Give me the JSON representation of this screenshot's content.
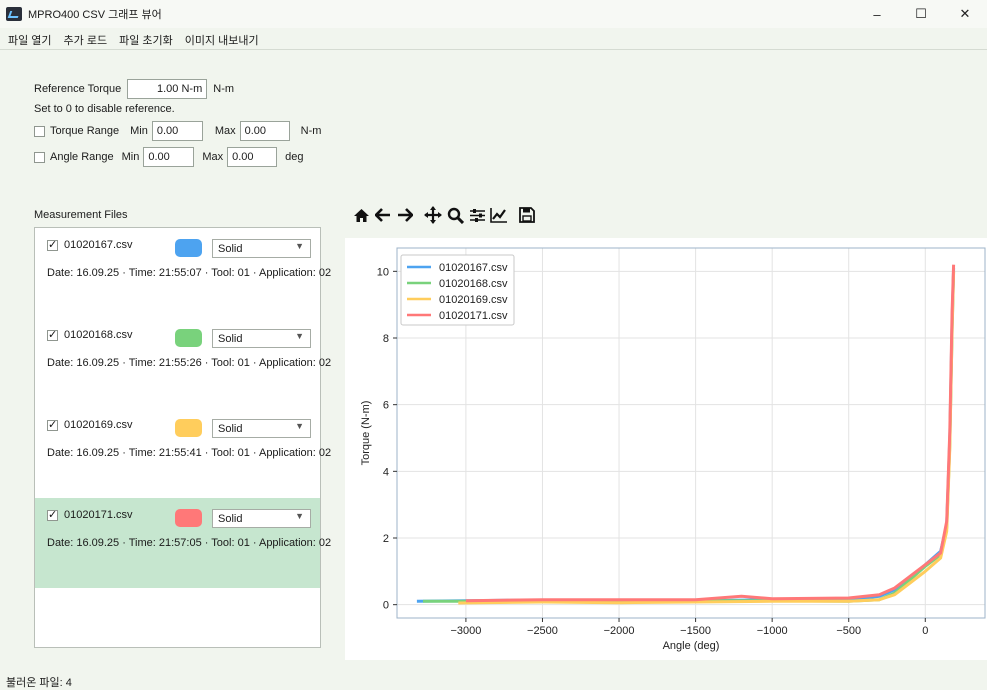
{
  "window": {
    "title": "MPRO400 CSV 그래프 뷰어",
    "icon": "app-chart-icon",
    "controls": [
      "–",
      "☐",
      "✕"
    ]
  },
  "menu": [
    "파일 열기",
    "추가 로드",
    "파일 초기화",
    "이미지 내보내기"
  ],
  "settings": {
    "ref_label": "Reference Torque",
    "ref_value": "1.00 N-m",
    "ref_unit": "N-m",
    "ref_hint": "Set to 0 to disable reference.",
    "torque_range": {
      "label": "Torque Range",
      "min_label": "Min",
      "min": "0.00",
      "max_label": "Max",
      "max": "0.00",
      "unit": "N-m",
      "checked": false
    },
    "angle_range": {
      "label": "Angle Range",
      "min_label": "Min",
      "min": "0.00",
      "max_label": "Max",
      "max": "0.00",
      "unit": "deg",
      "checked": false
    }
  },
  "files_label": "Measurement Files",
  "files": [
    {
      "name": "01020167.csv",
      "color": "#4da3f0",
      "style": "Solid",
      "info": "Date: 16.09.25 · Time: 21:55:07 · Tool: 01 · Application: 02",
      "checked": true,
      "selected": false
    },
    {
      "name": "01020168.csv",
      "color": "#79d27c",
      "style": "Solid",
      "info": "Date: 16.09.25 · Time: 21:55:26 · Tool: 01 · Application: 02",
      "checked": true,
      "selected": false
    },
    {
      "name": "01020169.csv",
      "color": "#ffcd5c",
      "style": "Solid",
      "info": "Date: 16.09.25 · Time: 21:55:41 · Tool: 01 · Application: 02",
      "checked": true,
      "selected": false
    },
    {
      "name": "01020171.csv",
      "color": "#ff7878",
      "style": "Solid",
      "info": "Date: 16.09.25 · Time: 21:57:05 · Tool: 01 · Application: 02",
      "checked": true,
      "selected": true
    }
  ],
  "toolbar": [
    "home-icon",
    "back-icon",
    "forward-icon",
    "pan-icon",
    "zoom-icon",
    "configure-subplots-icon",
    "edit-axis-icon",
    "save-icon"
  ],
  "chart_data": {
    "type": "line",
    "xlabel": "Angle (deg)",
    "ylabel": "Torque (N-m)",
    "xlim": [
      -3450,
      390
    ],
    "ylim": [
      -0.4,
      10.7
    ],
    "xticks": [
      -3000,
      -2500,
      -2000,
      -1500,
      -1000,
      -500,
      0
    ],
    "xtick_labels": [
      "−3000",
      "−2500",
      "−2000",
      "−1500",
      "−1000",
      "−500",
      "0"
    ],
    "yticks": [
      0,
      2,
      4,
      6,
      8,
      10
    ],
    "ytick_labels": [
      "0",
      "2",
      "4",
      "6",
      "8",
      "10"
    ],
    "grid": true,
    "legend_position": "top-left",
    "series": [
      {
        "name": "01020167.csv",
        "color": "#4da3f0",
        "x": [
          -3320,
          -3000,
          -2500,
          -2000,
          -1500,
          -1000,
          -500,
          -300,
          -200,
          -100,
          0,
          100,
          140,
          160,
          175,
          185
        ],
        "y": [
          0.1,
          0.12,
          0.14,
          0.12,
          0.12,
          0.15,
          0.15,
          0.25,
          0.45,
          0.8,
          1.2,
          1.6,
          2.4,
          5.0,
          8.5,
          10.1
        ]
      },
      {
        "name": "01020168.csv",
        "color": "#79d27c",
        "x": [
          -3280,
          -3000,
          -2500,
          -2000,
          -1500,
          -1000,
          -500,
          -300,
          -200,
          -100,
          0,
          100,
          140,
          160,
          175,
          185
        ],
        "y": [
          0.1,
          0.1,
          0.12,
          0.1,
          0.12,
          0.12,
          0.1,
          0.15,
          0.35,
          0.75,
          1.15,
          1.5,
          2.3,
          4.8,
          8.2,
          10.0
        ]
      },
      {
        "name": "01020169.csv",
        "color": "#ffcd5c",
        "x": [
          -3050,
          -2500,
          -2000,
          -1500,
          -1000,
          -500,
          -300,
          -200,
          -100,
          0,
          100,
          140,
          160,
          175,
          185
        ],
        "y": [
          0.05,
          0.08,
          0.06,
          0.08,
          0.1,
          0.1,
          0.15,
          0.3,
          0.65,
          1.0,
          1.4,
          2.2,
          4.7,
          8.3,
          10.0
        ]
      },
      {
        "name": "01020171.csv",
        "color": "#ff7878",
        "x": [
          -3000,
          -2500,
          -2000,
          -1500,
          -1200,
          -1000,
          -500,
          -300,
          -200,
          -100,
          0,
          100,
          140,
          160,
          175,
          185
        ],
        "y": [
          0.12,
          0.15,
          0.15,
          0.15,
          0.25,
          0.18,
          0.2,
          0.3,
          0.5,
          0.85,
          1.2,
          1.55,
          2.5,
          5.2,
          8.8,
          10.2
        ]
      }
    ]
  },
  "status": "불러온 파일: 4"
}
